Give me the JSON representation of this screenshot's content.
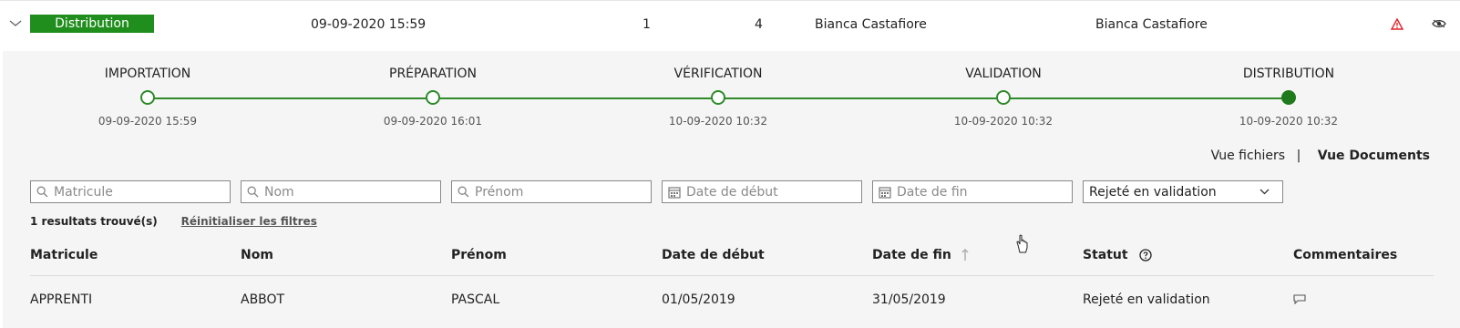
{
  "header_row": {
    "stage_badge": "Distribution",
    "datetime": "09-09-2020 15:59",
    "count_a": "1",
    "count_b": "4",
    "owner": "Bianca Castafiore",
    "assignee": "Bianca Castafiore",
    "warning_color": "#e0202a"
  },
  "stepper": {
    "accent": "#2f8a2a",
    "steps": [
      {
        "label": "IMPORTATION",
        "date": "09-09-2020 15:59"
      },
      {
        "label": "PRÉPARATION",
        "date": "09-09-2020 16:01"
      },
      {
        "label": "VÉRIFICATION",
        "date": "10-09-2020 10:32"
      },
      {
        "label": "VALIDATION",
        "date": "10-09-2020 10:32"
      },
      {
        "label": "DISTRIBUTION",
        "date": "10-09-2020 10:32"
      }
    ],
    "active_step": "DISTRIBUTION"
  },
  "view_toggle": {
    "files_label": "Vue fichiers",
    "separator": "|",
    "documents_label": "Vue Documents",
    "selected": "Vue Documents"
  },
  "filters": {
    "matricule_placeholder": "Matricule",
    "nom_placeholder": "Nom",
    "prenom_placeholder": "Prénom",
    "date_debut_placeholder": "Date de début",
    "date_fin_placeholder": "Date de fin",
    "status_value": "Rejeté en validation"
  },
  "results": {
    "count_text": "1 resultats trouvé(s)",
    "reset_label": "Réinitialiser les filtres"
  },
  "table": {
    "columns": {
      "matricule": "Matricule",
      "nom": "Nom",
      "prenom": "Prénom",
      "date_debut": "Date de début",
      "date_fin": "Date de fin",
      "statut": "Statut",
      "commentaires": "Commentaires"
    },
    "sorted_column": "Date de fin",
    "sort_direction": "ascending",
    "rows": [
      {
        "matricule": "APPRENTI",
        "nom": "ABBOT",
        "prenom": "PASCAL",
        "date_debut": "01/05/2019",
        "date_fin": "31/05/2019",
        "statut": "Rejeté en validation"
      }
    ]
  }
}
